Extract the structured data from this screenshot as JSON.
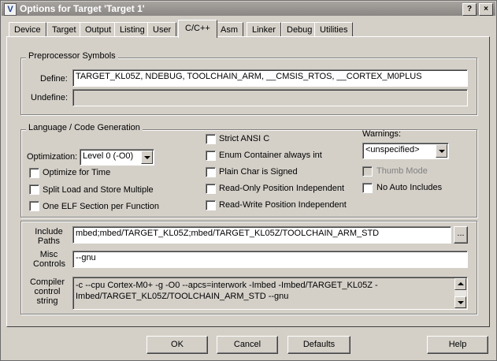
{
  "window": {
    "title": "Options for Target 'Target 1'",
    "icon": "V",
    "help_btn": "?",
    "close_btn": "×"
  },
  "tabs": [
    {
      "label": "Device"
    },
    {
      "label": "Target"
    },
    {
      "label": "Output"
    },
    {
      "label": "Listing"
    },
    {
      "label": "User"
    },
    {
      "label": "C/C++"
    },
    {
      "label": "Asm"
    },
    {
      "label": "Linker"
    },
    {
      "label": "Debug"
    },
    {
      "label": "Utilities"
    }
  ],
  "preprocessor": {
    "group_label": "Preprocessor Symbols",
    "define_label": "Define:",
    "define_value": "TARGET_KL05Z, NDEBUG, TOOLCHAIN_ARM, __CMSIS_RTOS, __CORTEX_M0PLUS",
    "undefine_label": "Undefine:",
    "undefine_value": ""
  },
  "language": {
    "group_label": "Language / Code Generation",
    "optimization_label": "Optimization:",
    "optimization_value": "Level 0 (-O0)",
    "checks": {
      "optimize_time": "Optimize for Time",
      "split_load": "Split Load and Store Multiple",
      "one_elf": "One ELF Section per Function",
      "strict_ansi": "Strict ANSI C",
      "enum_container": "Enum Container always int",
      "plain_char": "Plain Char is Signed",
      "ro_pos": "Read-Only Position Independent",
      "rw_pos": "Read-Write Position Independent",
      "thumb_mode": "Thumb Mode",
      "no_auto_includes": "No Auto Includes"
    },
    "warnings_label": "Warnings:",
    "warnings_value": "<unspecified>"
  },
  "include_paths": {
    "label_line1": "Include",
    "label_line2": "Paths",
    "value": "mbed;mbed/TARGET_KL05Z;mbed/TARGET_KL05Z/TOOLCHAIN_ARM_STD",
    "browse": "..."
  },
  "misc_controls": {
    "label_line1": "Misc",
    "label_line2": "Controls",
    "value": "--gnu"
  },
  "compiler_string": {
    "label_line1": "Compiler",
    "label_line2": "control",
    "label_line3": "string",
    "line1": "-c --cpu Cortex-M0+ -g -O0 --apcs=interwork -Imbed -Imbed/TARGET_KL05Z -",
    "line2": "Imbed/TARGET_KL05Z/TOOLCHAIN_ARM_STD --gnu"
  },
  "buttons": {
    "ok": "OK",
    "cancel": "Cancel",
    "defaults": "Defaults",
    "help": "Help"
  }
}
